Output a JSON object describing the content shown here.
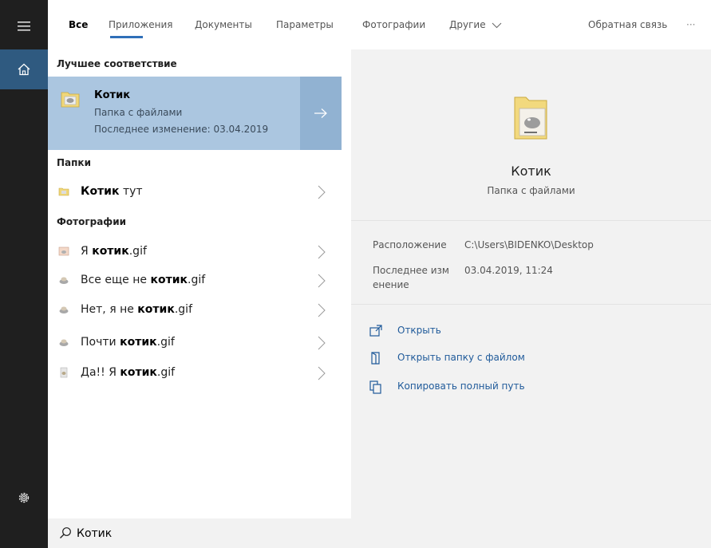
{
  "tabs": [
    {
      "label": "Все"
    },
    {
      "label": "Приложения"
    },
    {
      "label": "Документы"
    },
    {
      "label": "Параметры"
    },
    {
      "label": "Фотографии"
    },
    {
      "label": "Другие"
    }
  ],
  "feedback_label": "Обратная связь",
  "more_label": "···",
  "best_match": {
    "section": "Лучшее соответствие",
    "title": "Котик",
    "subtitle": "Папка с файлами",
    "modified": "Последнее изменение: 03.04.2019"
  },
  "folders": {
    "section": "Папки",
    "items": [
      {
        "bold": "Котик",
        "text": " тут"
      }
    ]
  },
  "photos": {
    "section": "Фотографии",
    "items": [
      {
        "pre": "Я ",
        "bold": "котик",
        "post": ".gif"
      },
      {
        "pre": "Все еще не ",
        "bold": "котик",
        "post": ".gif"
      },
      {
        "pre": "Нет, я не ",
        "bold": "котик",
        "post": ".gif"
      },
      {
        "pre": "Почти ",
        "bold": "котик",
        "post": ".gif"
      },
      {
        "pre": "Да!! Я ",
        "bold": "котик",
        "post": ".gif"
      }
    ]
  },
  "detail": {
    "name": "Котик",
    "type": "Папка с файлами",
    "location_label": "Расположение",
    "location_value": "C:\\Users\\BIDENKO\\Desktop",
    "modified_label_1": "Последнее изм",
    "modified_label_2": "енение",
    "modified_value": "03.04.2019, 11:24",
    "actions": [
      {
        "label": "Открыть",
        "icon": "open-icon"
      },
      {
        "label": "Открыть папку с файлом",
        "icon": "folder-icon"
      },
      {
        "label": "Копировать полный путь",
        "icon": "copy-icon"
      }
    ]
  },
  "search": {
    "value": "Котик"
  },
  "colors": {
    "rail": "#1f1f1f",
    "rail_active": "#2f5a80",
    "selection": "#abc6e0",
    "selection_arrow": "#91b2d2",
    "accent": "#2f6fb8",
    "link": "#1f5a9a"
  }
}
